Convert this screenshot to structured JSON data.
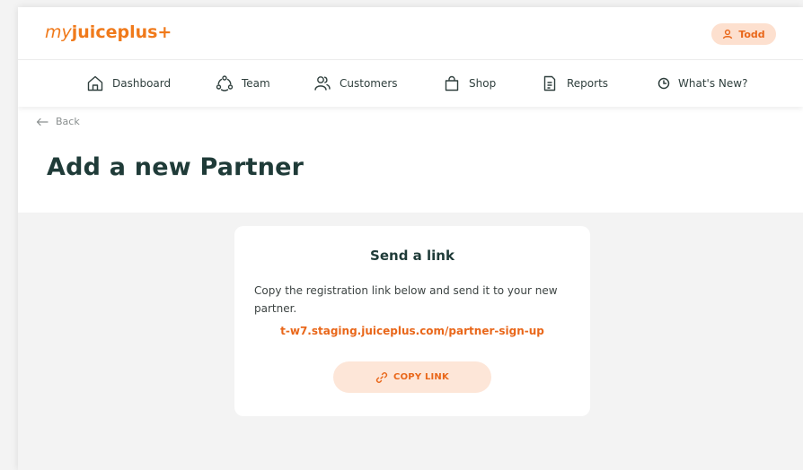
{
  "header": {
    "logo_prefix": "my",
    "logo_brand": "juiceplus+",
    "user_name": "Todd",
    "user_icon": "user-icon"
  },
  "nav": {
    "items": [
      {
        "label": "Dashboard",
        "icon": "home-icon"
      },
      {
        "label": "Team",
        "icon": "team-icon"
      },
      {
        "label": "Customers",
        "icon": "customers-icon"
      },
      {
        "label": "Shop",
        "icon": "shopping-bag-icon"
      },
      {
        "label": "Reports",
        "icon": "document-icon"
      },
      {
        "label": "What's New?",
        "icon": "clock-icon"
      }
    ]
  },
  "page": {
    "back_label": "Back",
    "title": "Add a new Partner"
  },
  "card": {
    "title": "Send a link",
    "description": "Copy the registration link below and send it to your new partner.",
    "link": "t-w7.staging.juiceplus.com/partner-sign-up",
    "button_label": "COPY LINK",
    "button_icon": "link-icon"
  },
  "colors": {
    "accent": "#e9671a",
    "accent_light": "#fde6d8",
    "heading": "#1f3b38",
    "background": "#f3f3f3"
  }
}
